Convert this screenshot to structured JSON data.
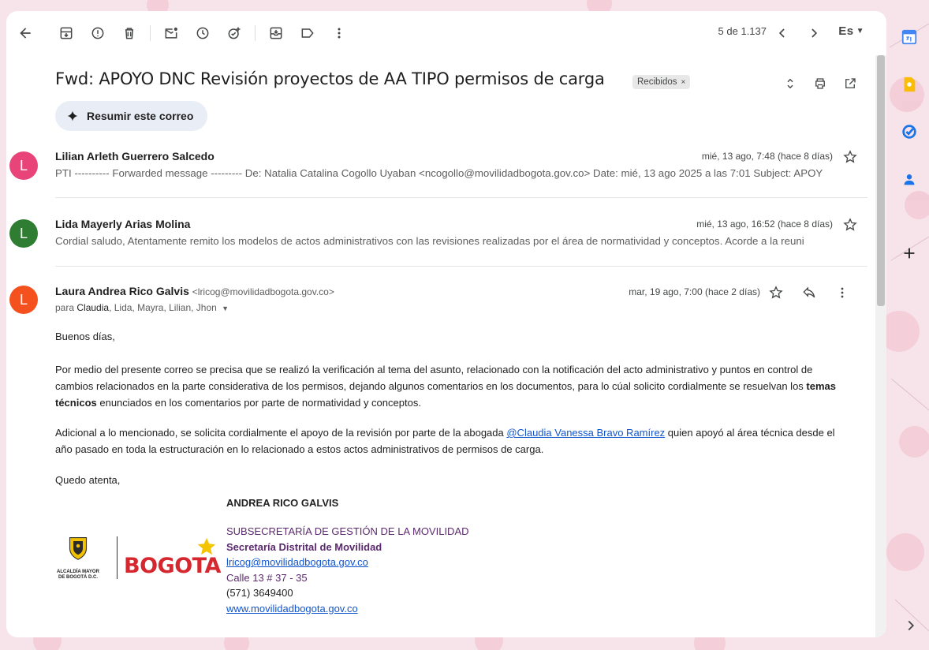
{
  "toolbar": {
    "pager": "5 de 1.137",
    "lang": "Es"
  },
  "subject": "Fwd: APOYO DNC Revisión proyectos de AA TIPO permisos de carga",
  "label": "Recibidos",
  "summarize_label": "Resumir este correo",
  "messages": [
    {
      "initial": "L",
      "color": "#e8447a",
      "sender": "Lilian Arleth Guerrero Salcedo",
      "date": "mié, 13 ago, 7:48 (hace 8 días)",
      "snippet": "PTI ---------- Forwarded message --------- De: Natalia Catalina Cogollo Uyaban <ncogollo@movilidadbogota.gov.co> Date: mié, 13 ago 2025 a las 7:01 Subject: APOY"
    },
    {
      "initial": "L",
      "color": "#2e7d32",
      "sender": "Lida Mayerly Arias Molina",
      "date": "mié, 13 ago, 16:52 (hace 8 días)",
      "snippet": "Cordial saludo, Atentamente remito los modelos de actos administrativos con las revisiones realizadas por el área de normatividad y conceptos. Acorde a la reuni"
    }
  ],
  "open_message": {
    "initial": "L",
    "color": "#f4511e",
    "sender": "Laura Andrea Rico Galvis",
    "email": "<lricog@movilidadbogota.gov.co>",
    "date": "mar, 19 ago, 7:00 (hace 2 días)",
    "to_prefix": "para",
    "to_first": "Claudia",
    "to_rest": ", Lida, Mayra, Lilian, Jhon",
    "greeting": "Buenos días,",
    "p1_a": "Por medio del presente correo se precisa que se realizó la verificación al tema del asunto, relacionado con la notificación del acto administrativo y puntos en control de cambios relacionados en la parte considerativa de los permisos, dejando algunos comentarios en los documentos,  para lo cúal solicito cordialmente se resuelvan los ",
    "p1_bold": "temas técnicos",
    "p1_b": " enunciados en los comentarios por parte de normatividad y conceptos.",
    "p2_a": "Adicional a lo mencionado, se solicita cordialmente el apoyo de la revisión por parte de la abogada ",
    "p2_link": "@Claudia Vanessa Bravo Ramírez",
    "p2_b": " quien apoyó al área técnica desde el año pasado en toda la estructuración en lo relacionado a estos actos administrativos de permisos de carga.",
    "closing": "Quedo atenta,",
    "signature": {
      "name": "ANDREA RICO GALVIS",
      "subsecretaria": "SUBSECRETARÍA DE GESTIÓN DE LA MOVILIDAD",
      "secretaria": "Secretaría Distrital de Movilidad",
      "email": "lricog@movilidadbogota.gov.co",
      "address": "Calle 13 # 37 - 35",
      "phone": "(571) 3649400",
      "web": "www.movilidadbogota.gov.co",
      "crest_text_1": "ALCALDÍA MAYOR",
      "crest_text_2": "DE BOGOTÁ D.C.",
      "logo_text": "BOGOTA"
    }
  }
}
